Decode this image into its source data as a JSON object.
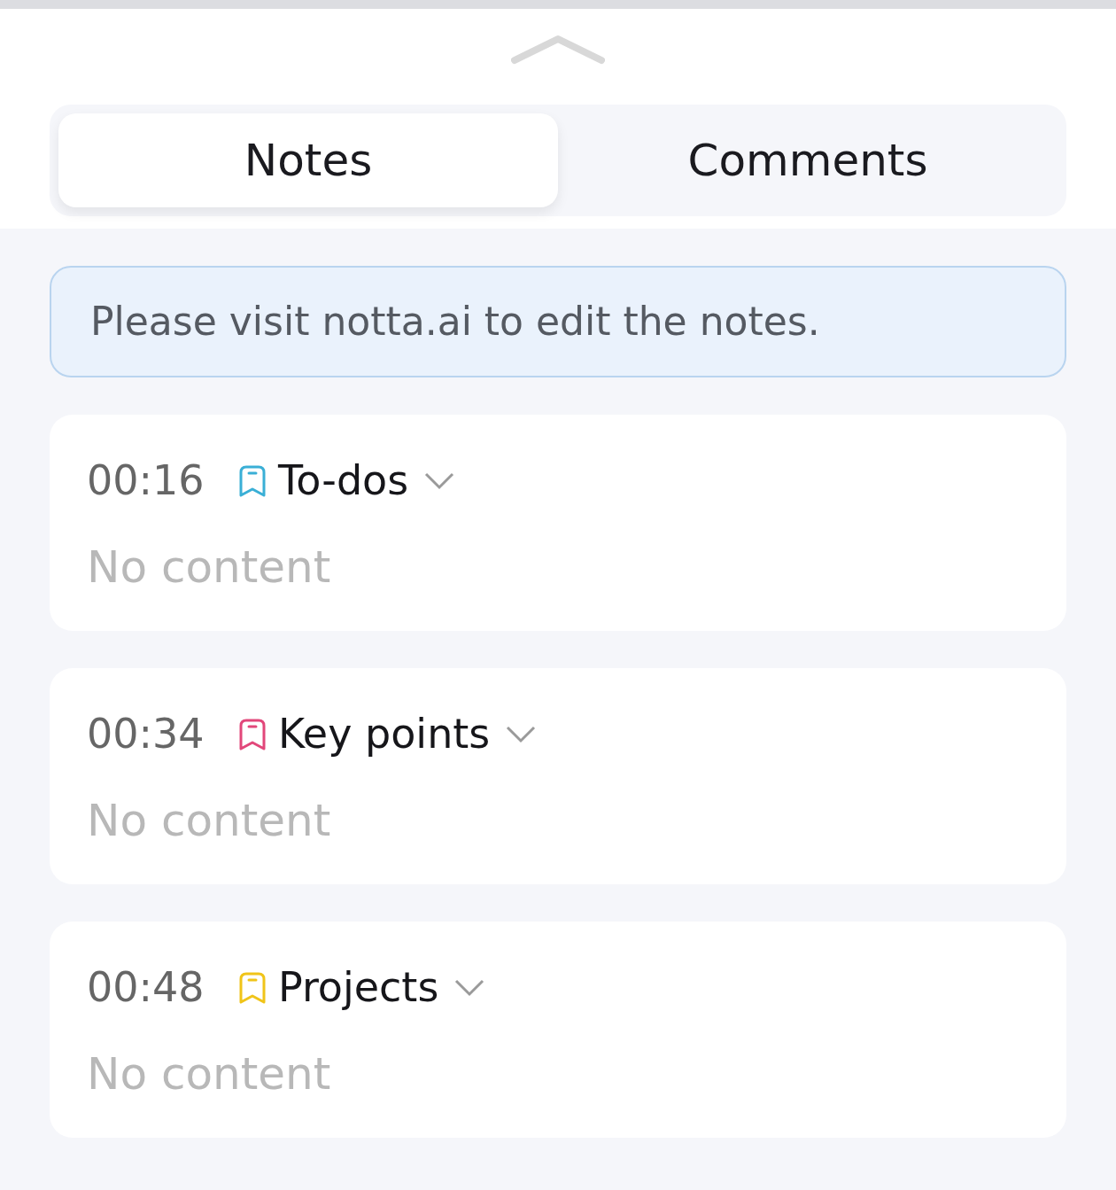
{
  "tabs": [
    {
      "label": "Notes",
      "selected": true
    },
    {
      "label": "Comments",
      "selected": false
    }
  ],
  "notice": "Please visit notta.ai to edit the notes.",
  "notes": [
    {
      "time": "00:16",
      "tag": "To-dos",
      "color": "#3aafd6",
      "content": "No content"
    },
    {
      "time": "00:34",
      "tag": "Key points",
      "color": "#e2477a",
      "content": "No content"
    },
    {
      "time": "00:48",
      "tag": "Projects",
      "color": "#f0c419",
      "content": "No content"
    }
  ]
}
